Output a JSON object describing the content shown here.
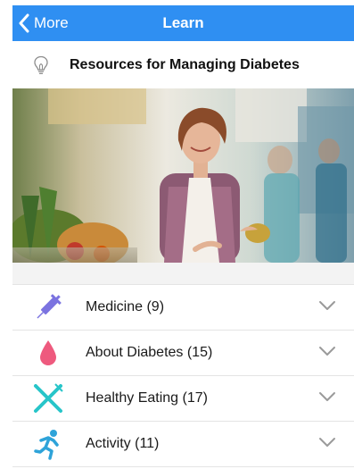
{
  "navbar": {
    "back_label": "More",
    "title": "Learn"
  },
  "header": {
    "title": "Resources for Managing Diabetes",
    "icon": "lightbulb-icon"
  },
  "hero": {
    "description": "photo-woman-at-farmers-market"
  },
  "categories": [
    {
      "label": "Medicine (9)",
      "icon": "syringe-icon",
      "color": "#7b73e0"
    },
    {
      "label": "About Diabetes (15)",
      "icon": "blood-drop-icon",
      "color": "#ee5a7e"
    },
    {
      "label": "Healthy Eating (17)",
      "icon": "fork-knife-icon",
      "color": "#27c5c9"
    },
    {
      "label": "Activity (11)",
      "icon": "running-person-icon",
      "color": "#2ea3d9"
    }
  ],
  "colors": {
    "navbar": "#2f8ff2",
    "divider": "#e4e4e4",
    "chevron": "#9a9a9a"
  }
}
